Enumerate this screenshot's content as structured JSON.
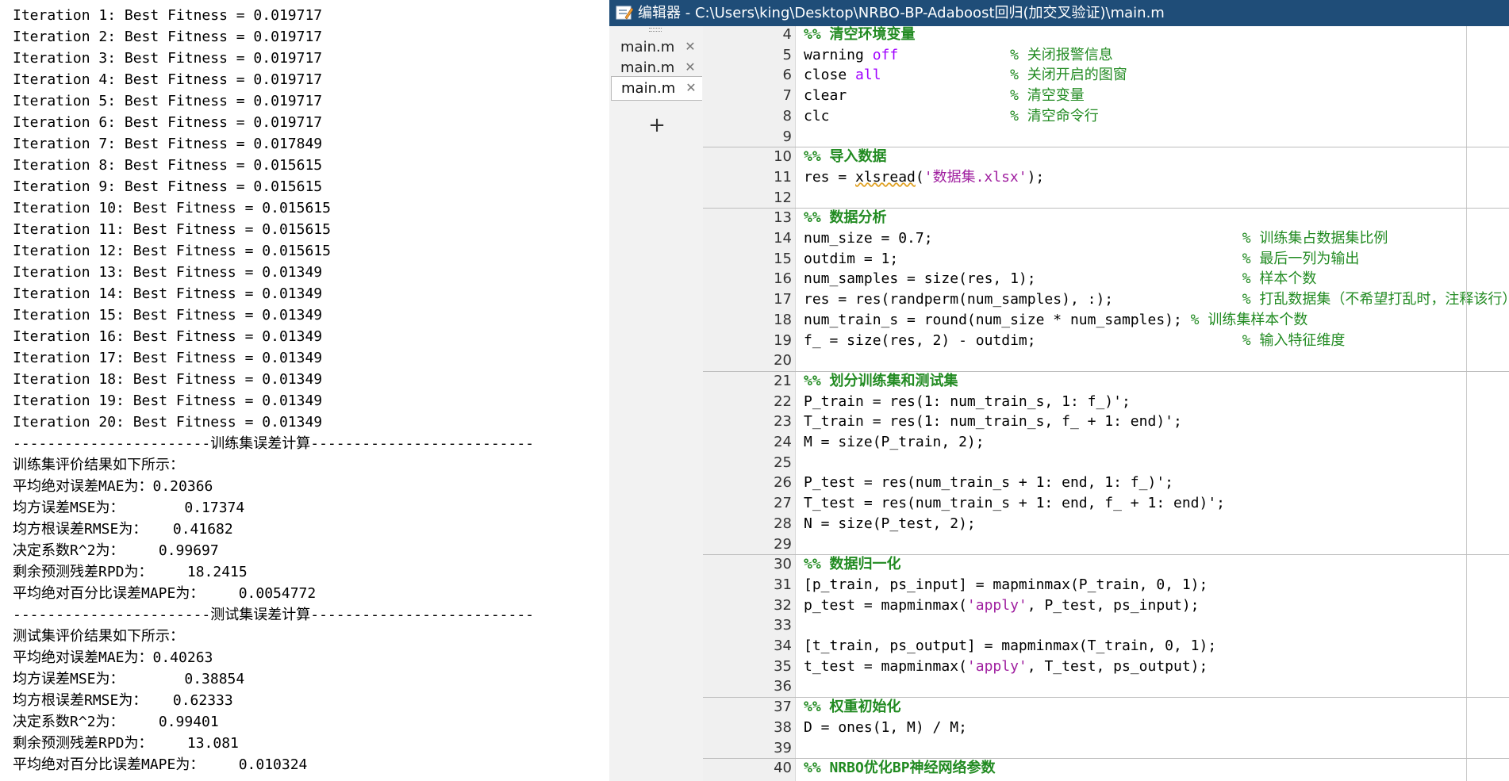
{
  "console": {
    "lines": [
      "Iteration 1: Best Fitness = 0.019717",
      "Iteration 2: Best Fitness = 0.019717",
      "Iteration 3: Best Fitness = 0.019717",
      "Iteration 4: Best Fitness = 0.019717",
      "Iteration 5: Best Fitness = 0.019717",
      "Iteration 6: Best Fitness = 0.019717",
      "Iteration 7: Best Fitness = 0.017849",
      "Iteration 8: Best Fitness = 0.015615",
      "Iteration 9: Best Fitness = 0.015615",
      "Iteration 10: Best Fitness = 0.015615",
      "Iteration 11: Best Fitness = 0.015615",
      "Iteration 12: Best Fitness = 0.015615",
      "Iteration 13: Best Fitness = 0.01349",
      "Iteration 14: Best Fitness = 0.01349",
      "Iteration 15: Best Fitness = 0.01349",
      "Iteration 16: Best Fitness = 0.01349",
      "Iteration 17: Best Fitness = 0.01349",
      "Iteration 18: Best Fitness = 0.01349",
      "Iteration 19: Best Fitness = 0.01349",
      "Iteration 20: Best Fitness = 0.01349",
      "-----------------------训练集误差计算--------------------------",
      "训练集评价结果如下所示：",
      "平均绝对误差MAE为：0.20366",
      "均方误差MSE为：       0.17374",
      "均方根误差RMSE为：   0.41682",
      "决定系数R^2为：    0.99697",
      "剩余预测残差RPD为：    18.2415",
      "平均绝对百分比误差MAPE为：    0.0054772",
      "-----------------------测试集误差计算--------------------------",
      "测试集评价结果如下所示：",
      "平均绝对误差MAE为：0.40263",
      "均方误差MSE为：       0.38854",
      "均方根误差RMSE为：   0.62333",
      "决定系数R^2为：    0.99401",
      "剩余预测残差RPD为：    13.081",
      "平均绝对百分比误差MAPE为：    0.010324"
    ]
  },
  "editor": {
    "title": "编辑器 - C:\\Users\\king\\Desktop\\NRBO-BP-Adaboost回归(加交叉验证)\\main.m",
    "tabs": [
      {
        "label": "main.m",
        "active": false
      },
      {
        "label": "main.m",
        "active": false
      },
      {
        "label": "main.m",
        "active": true
      }
    ],
    "add_tab_symbol": "+",
    "close_symbol": "✕",
    "code": [
      {
        "no": "4",
        "segs": [
          {
            "t": "%% 清空环境变量",
            "c": "sec"
          }
        ]
      },
      {
        "no": "5",
        "segs": [
          {
            "t": "warning "
          },
          {
            "t": "off",
            "c": "kw"
          },
          {
            "t": "             "
          },
          {
            "t": "% 关闭报警信息",
            "c": "cm"
          }
        ]
      },
      {
        "no": "6",
        "segs": [
          {
            "t": "close "
          },
          {
            "t": "all",
            "c": "kw"
          },
          {
            "t": "               "
          },
          {
            "t": "% 关闭开启的图窗",
            "c": "cm"
          }
        ]
      },
      {
        "no": "7",
        "segs": [
          {
            "t": "clear                   "
          },
          {
            "t": "% 清空变量",
            "c": "cm"
          }
        ]
      },
      {
        "no": "8",
        "segs": [
          {
            "t": "clc                     "
          },
          {
            "t": "% 清空命令行",
            "c": "cm"
          }
        ]
      },
      {
        "no": "9",
        "segs": []
      },
      {
        "no": "10",
        "segs": [
          {
            "t": "%% 导入数据",
            "c": "sec"
          }
        ]
      },
      {
        "no": "11",
        "segs": [
          {
            "t": "res = "
          },
          {
            "t": "xlsread",
            "c": "wavy"
          },
          {
            "t": "("
          },
          {
            "t": "'数据集.xlsx'",
            "c": "str"
          },
          {
            "t": ");"
          }
        ]
      },
      {
        "no": "12",
        "segs": []
      },
      {
        "no": "13",
        "segs": [
          {
            "t": "%% 数据分析",
            "c": "sec"
          }
        ]
      },
      {
        "no": "14",
        "segs": [
          {
            "t": "num_size = 0.7;                                    "
          },
          {
            "t": "% 训练集占数据集比例",
            "c": "cm"
          }
        ]
      },
      {
        "no": "15",
        "segs": [
          {
            "t": "outdim = 1;                                        "
          },
          {
            "t": "% 最后一列为输出",
            "c": "cm"
          }
        ]
      },
      {
        "no": "16",
        "segs": [
          {
            "t": "num_samples = size(res, 1);                        "
          },
          {
            "t": "% 样本个数",
            "c": "cm"
          }
        ]
      },
      {
        "no": "17",
        "segs": [
          {
            "t": "res = res(randperm(num_samples), :);               "
          },
          {
            "t": "% 打乱数据集（不希望打乱时，注释该行）",
            "c": "cm"
          }
        ]
      },
      {
        "no": "18",
        "segs": [
          {
            "t": "num_train_s = round(num_size * num_samples); "
          },
          {
            "t": "% 训练集样本个数",
            "c": "cm"
          }
        ]
      },
      {
        "no": "19",
        "segs": [
          {
            "t": "f_ = size(res, 2) - outdim;                        "
          },
          {
            "t": "% 输入特征维度",
            "c": "cm"
          }
        ]
      },
      {
        "no": "20",
        "segs": []
      },
      {
        "no": "21",
        "segs": [
          {
            "t": "%% 划分训练集和测试集",
            "c": "sec"
          }
        ]
      },
      {
        "no": "22",
        "segs": [
          {
            "t": "P_train = res(1: num_train_s, 1: f_)';"
          }
        ]
      },
      {
        "no": "23",
        "segs": [
          {
            "t": "T_train = res(1: num_train_s, f_ + 1: end)';"
          }
        ]
      },
      {
        "no": "24",
        "segs": [
          {
            "t": "M = size(P_train, 2);"
          }
        ]
      },
      {
        "no": "25",
        "segs": []
      },
      {
        "no": "26",
        "segs": [
          {
            "t": "P_test = res(num_train_s + 1: end, 1: f_)';"
          }
        ]
      },
      {
        "no": "27",
        "segs": [
          {
            "t": "T_test = res(num_train_s + 1: end, f_ + 1: end)';"
          }
        ]
      },
      {
        "no": "28",
        "segs": [
          {
            "t": "N = size(P_test, 2);"
          }
        ]
      },
      {
        "no": "29",
        "segs": []
      },
      {
        "no": "30",
        "segs": [
          {
            "t": "%% 数据归一化",
            "c": "sec"
          }
        ]
      },
      {
        "no": "31",
        "segs": [
          {
            "t": "[p_train, ps_input] = mapminmax(P_train, 0, 1);"
          }
        ]
      },
      {
        "no": "32",
        "segs": [
          {
            "t": "p_test = mapminmax("
          },
          {
            "t": "'apply'",
            "c": "str"
          },
          {
            "t": ", P_test, ps_input);"
          }
        ]
      },
      {
        "no": "33",
        "segs": []
      },
      {
        "no": "34",
        "segs": [
          {
            "t": "[t_train, ps_output] = mapminmax(T_train, 0, 1);"
          }
        ]
      },
      {
        "no": "35",
        "segs": [
          {
            "t": "t_test = mapminmax("
          },
          {
            "t": "'apply'",
            "c": "str"
          },
          {
            "t": ", T_test, ps_output);"
          }
        ]
      },
      {
        "no": "36",
        "segs": []
      },
      {
        "no": "37",
        "segs": [
          {
            "t": "%% 权重初始化",
            "c": "sec"
          }
        ]
      },
      {
        "no": "38",
        "segs": [
          {
            "t": "D = ones(1, M) / M;"
          }
        ]
      },
      {
        "no": "39",
        "segs": []
      },
      {
        "no": "40",
        "segs": [
          {
            "t": "%% NRBO优化BP神经网络参数",
            "c": "sec"
          }
        ]
      }
    ]
  },
  "colors": {
    "titlebar": "#1f4d78",
    "keyword": "#a000ff",
    "string": "#a020a0",
    "comment": "#228b22"
  }
}
